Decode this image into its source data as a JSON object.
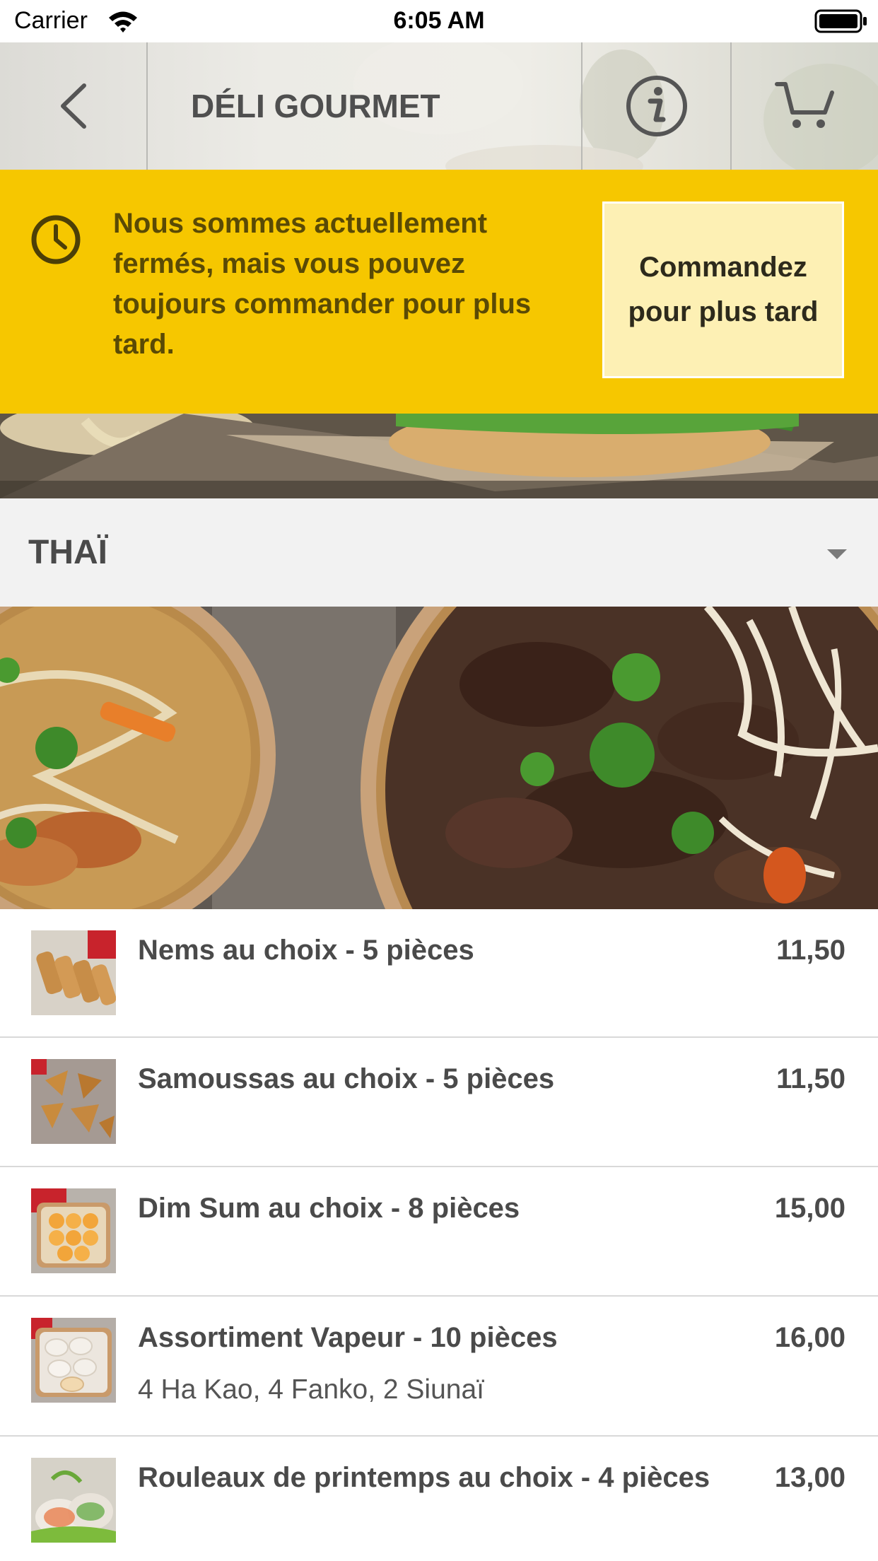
{
  "status_bar": {
    "carrier": "Carrier",
    "time": "6:05 AM"
  },
  "header": {
    "title": "DÉLI GOURMET",
    "back_icon": "chevron-left-icon",
    "info_icon": "info-icon",
    "cart_icon": "cart-icon"
  },
  "closed_banner": {
    "message": "Nous sommes actuellement fermés, mais vous pouvez toujours commander pour plus tard.",
    "order_later_label": "Commandez pour plus tard",
    "icon": "clock-icon",
    "background_color": "#f6c700"
  },
  "category": {
    "title": "THAÏ",
    "caret_icon": "caret-down-icon"
  },
  "menu_items": [
    {
      "name": "Nems au choix - 5 pièces",
      "description": "",
      "price": "11,50"
    },
    {
      "name": "Samoussas au choix - 5 pièces",
      "description": "",
      "price": "11,50"
    },
    {
      "name": "Dim Sum au choix - 8 pièces",
      "description": "",
      "price": "15,00"
    },
    {
      "name": "Assortiment Vapeur - 10 pièces",
      "description": "4 Ha Kao, 4 Fanko, 2 Siunaï",
      "price": "16,00"
    },
    {
      "name": "Rouleaux de printemps au choix - 4 pièces",
      "description": "",
      "price": "13,00"
    }
  ]
}
